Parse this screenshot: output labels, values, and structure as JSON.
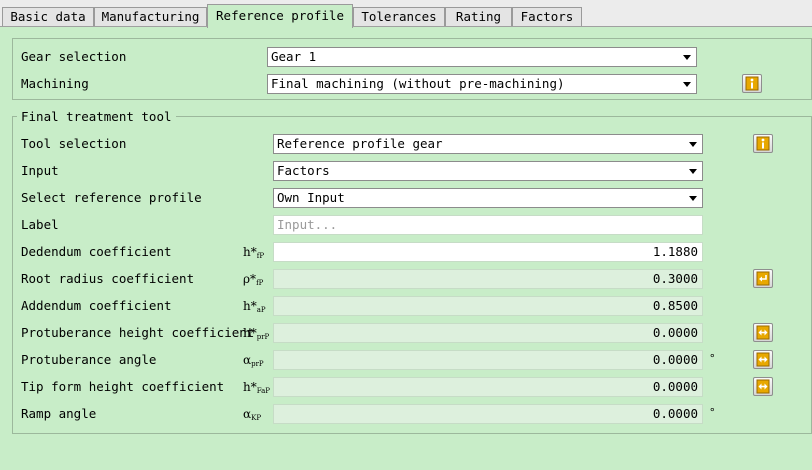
{
  "tabs": [
    {
      "label": "Basic data"
    },
    {
      "label": "Manufacturing"
    },
    {
      "label": "Reference profile"
    },
    {
      "label": "Tolerances"
    },
    {
      "label": "Rating"
    },
    {
      "label": "Factors"
    }
  ],
  "active_tab": "Reference profile",
  "top": {
    "gear_selection": {
      "label": "Gear selection",
      "value": "Gear 1"
    },
    "machining": {
      "label": "Machining",
      "value": "Final machining (without pre-machining)"
    }
  },
  "final_tool": {
    "title": "Final treatment tool",
    "tool_selection": {
      "label": "Tool selection",
      "value": "Reference profile gear"
    },
    "input": {
      "label": "Input",
      "value": "Factors"
    },
    "reference_profile": {
      "label": "Select reference profile",
      "value": "Own Input"
    },
    "label_field": {
      "label": "Label",
      "placeholder": "Input..."
    },
    "rows": [
      {
        "label": "Dedendum coefficient",
        "sym": "h*",
        "sub": "fP",
        "value": "1.1880",
        "unit": ""
      },
      {
        "label": "Root radius coefficient",
        "sym": "ρ*",
        "sub": "fP",
        "value": "0.3000",
        "unit": ""
      },
      {
        "label": "Addendum coefficient",
        "sym": "h*",
        "sub": "aP",
        "value": "0.8500",
        "unit": ""
      },
      {
        "label": "Protuberance height coefficient",
        "sym": "h*",
        "sub": "prP",
        "value": "0.0000",
        "unit": ""
      },
      {
        "label": "Protuberance angle",
        "sym": "α",
        "sub": "prP",
        "value": "0.0000",
        "unit": "°"
      },
      {
        "label": "Tip form height coefficient",
        "sym": "h*",
        "sub": "FaP",
        "value": "0.0000",
        "unit": ""
      },
      {
        "label": "Ramp angle",
        "sym": "α",
        "sub": "KP",
        "value": "0.0000",
        "unit": "°"
      }
    ]
  },
  "colors": {
    "panel": "#c8edc8",
    "info_icon": "#e8a800",
    "arrow_icon": "#e8a800"
  }
}
